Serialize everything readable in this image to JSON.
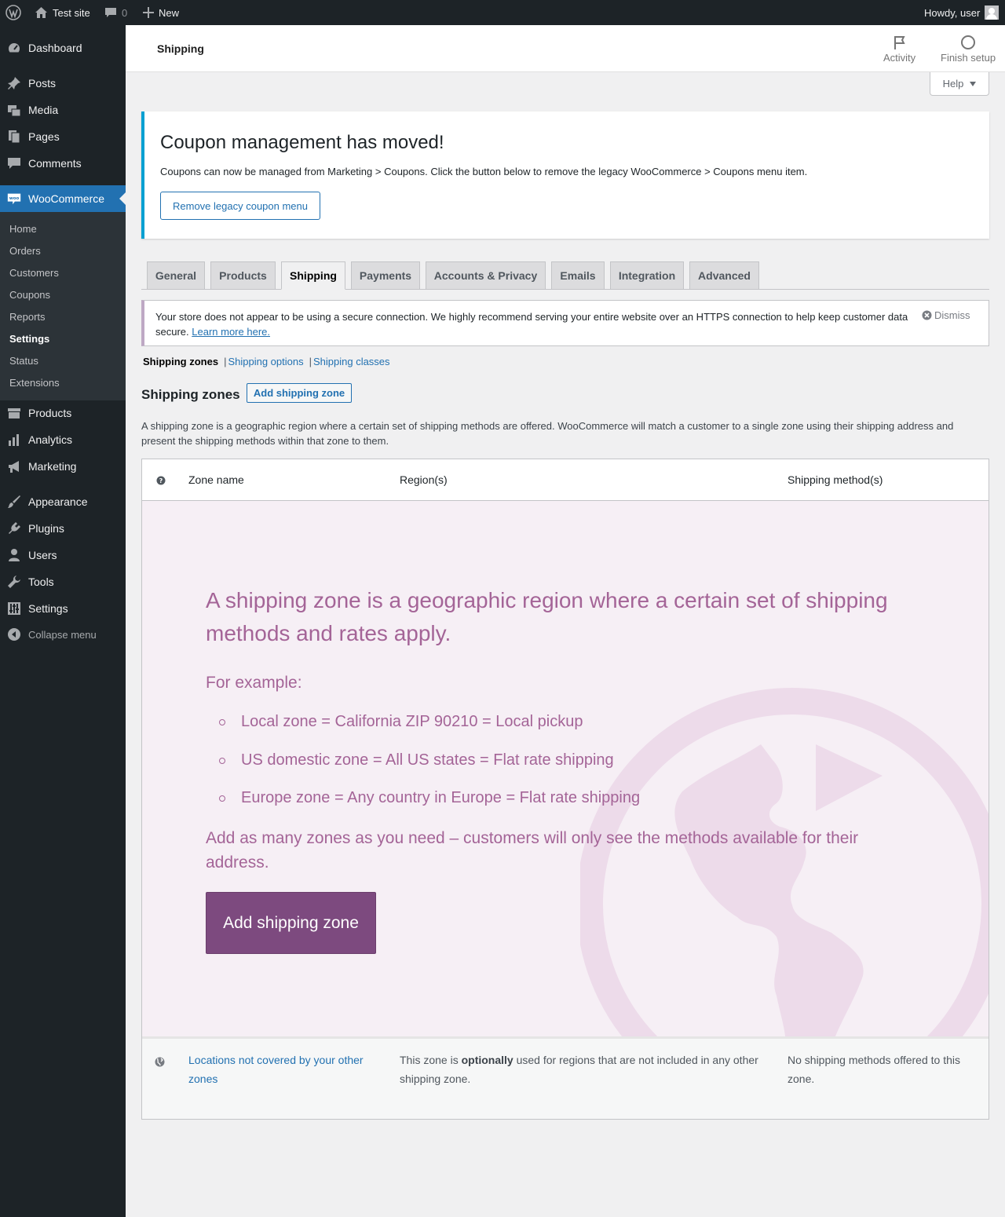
{
  "admin_bar": {
    "site_name": "Test site",
    "comments_count": "0",
    "new_label": "New",
    "greeting": "Howdy, user"
  },
  "sidebar": {
    "items_top": [
      {
        "label": "Dashboard",
        "icon": "dashboard-icon"
      },
      {
        "label": "Posts",
        "icon": "pushpin-icon"
      },
      {
        "label": "Media",
        "icon": "media-icon"
      },
      {
        "label": "Pages",
        "icon": "pages-icon"
      },
      {
        "label": "Comments",
        "icon": "comment-icon"
      },
      {
        "label": "WooCommerce",
        "icon": "woo-icon"
      }
    ],
    "woo_submenu": [
      "Home",
      "Orders",
      "Customers",
      "Coupons",
      "Reports",
      "Settings",
      "Status",
      "Extensions"
    ],
    "items_bottom": [
      {
        "label": "Products",
        "icon": "archive-icon"
      },
      {
        "label": "Analytics",
        "icon": "bar-chart-icon"
      },
      {
        "label": "Marketing",
        "icon": "megaphone-icon"
      },
      {
        "label": "Appearance",
        "icon": "brush-icon"
      },
      {
        "label": "Plugins",
        "icon": "plug-icon"
      },
      {
        "label": "Users",
        "icon": "user-icon"
      },
      {
        "label": "Tools",
        "icon": "wrench-icon"
      },
      {
        "label": "Settings",
        "icon": "sliders-icon"
      }
    ],
    "collapse_label": "Collapse menu"
  },
  "header": {
    "title": "Shipping",
    "activity_label": "Activity",
    "finish_setup_label": "Finish setup"
  },
  "help_label": "Help",
  "coupon_notice": {
    "title": "Coupon management has moved!",
    "text": "Coupons can now be managed from Marketing > Coupons. Click the button below to remove the legacy WooCommerce > Coupons menu item.",
    "button": "Remove legacy coupon menu"
  },
  "tabs": [
    "General",
    "Products",
    "Shipping",
    "Payments",
    "Accounts & Privacy",
    "Emails",
    "Integration",
    "Advanced"
  ],
  "active_tab": "Shipping",
  "https_notice": {
    "text": "Your store does not appear to be using a secure connection. We highly recommend serving your entire website over an HTTPS connection to help keep customer data secure.",
    "link": "Learn more here.",
    "dismiss": "Dismiss"
  },
  "subnav": {
    "current": "Shipping zones",
    "links": [
      "Shipping options",
      "Shipping classes"
    ]
  },
  "zones": {
    "title": "Shipping zones",
    "add_button": "Add shipping zone",
    "description": "A shipping zone is a geographic region where a certain set of shipping methods are offered. WooCommerce will match a customer to a single zone using their shipping address and present the shipping methods within that zone to them.",
    "columns": [
      "Zone name",
      "Region(s)",
      "Shipping method(s)"
    ]
  },
  "blank_state": {
    "lead": "A shipping zone is a geographic region where a certain set of shipping methods and rates apply.",
    "example_heading": "For example:",
    "examples": [
      "Local zone = California ZIP 90210 = Local pickup",
      "US domestic zone = All US states = Flat rate shipping",
      "Europe zone = Any country in Europe = Flat rate shipping"
    ],
    "outro": "Add as many zones as you need – customers will only see the methods available for their address.",
    "button": "Add shipping zone"
  },
  "rest_of_world": {
    "name": "Locations not covered by your other zones",
    "desc_before": "This zone is ",
    "desc_bold": "optionally",
    "desc_after": " used for regions that are not included in any other shipping zone.",
    "methods": "No shipping methods offered to this zone."
  },
  "colors": {
    "admin_dark": "#1d2327",
    "wp_blue": "#2271b1",
    "woo_purple": "#7d4a7f",
    "blank_text": "#a46497",
    "blank_bg": "#f6eff5"
  }
}
